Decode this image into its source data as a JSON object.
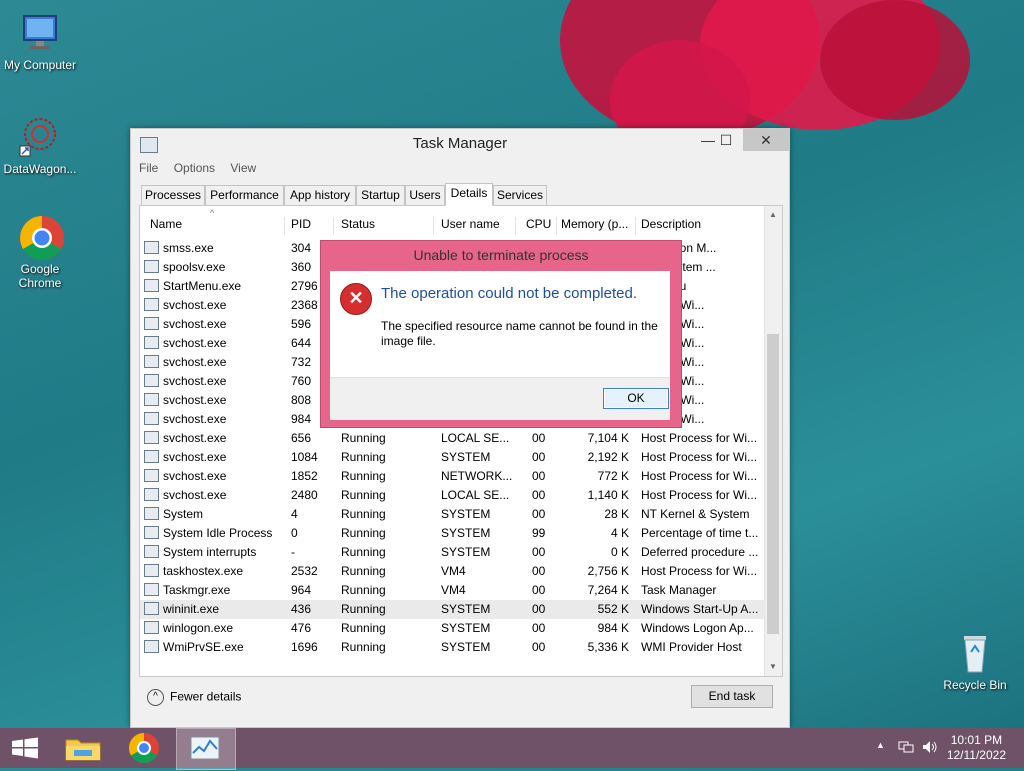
{
  "desktop": {
    "icons": [
      {
        "label": "My Computer",
        "icon": "computer-icon"
      },
      {
        "label": "DataWagon...",
        "icon": "datawagon-icon"
      },
      {
        "label": "Google Chrome",
        "icon": "chrome-icon"
      },
      {
        "label": "Recycle Bin",
        "icon": "recycle-bin-icon"
      }
    ]
  },
  "window": {
    "title": "Task Manager",
    "controls": {
      "minimize": "—",
      "maximize": "☐",
      "close": "✕"
    },
    "menu": [
      "File",
      "Options",
      "View"
    ],
    "tabs": [
      "Processes",
      "Performance",
      "App history",
      "Startup",
      "Users",
      "Details",
      "Services"
    ],
    "active_tab": "Details",
    "columns": [
      "Name",
      "PID",
      "Status",
      "User name",
      "CPU",
      "Memory (p...",
      "Description"
    ],
    "rows": [
      {
        "name": "smss.exe",
        "pid": "304",
        "status": "",
        "user": "",
        "cpu": "",
        "mem": "",
        "desc": "s Session M..."
      },
      {
        "name": "spoolsv.exe",
        "pid": "360",
        "status": "",
        "user": "",
        "cpu": "",
        "mem": "",
        "desc": "SubSystem ..."
      },
      {
        "name": "StartMenu.exe",
        "pid": "2796",
        "status": "",
        "user": "",
        "cpu": "",
        "mem": "",
        "desc": "ell Menu"
      },
      {
        "name": "svchost.exe",
        "pid": "2368",
        "status": "",
        "user": "",
        "cpu": "",
        "mem": "",
        "desc": "ess for Wi..."
      },
      {
        "name": "svchost.exe",
        "pid": "596",
        "status": "",
        "user": "",
        "cpu": "",
        "mem": "",
        "desc": "ess for Wi..."
      },
      {
        "name": "svchost.exe",
        "pid": "644",
        "status": "",
        "user": "",
        "cpu": "",
        "mem": "",
        "desc": "ess for Wi..."
      },
      {
        "name": "svchost.exe",
        "pid": "732",
        "status": "",
        "user": "",
        "cpu": "",
        "mem": "",
        "desc": "ess for Wi..."
      },
      {
        "name": "svchost.exe",
        "pid": "760",
        "status": "",
        "user": "",
        "cpu": "",
        "mem": "",
        "desc": "ess for Wi..."
      },
      {
        "name": "svchost.exe",
        "pid": "808",
        "status": "",
        "user": "",
        "cpu": "",
        "mem": "",
        "desc": "ess for Wi..."
      },
      {
        "name": "svchost.exe",
        "pid": "984",
        "status": "",
        "user": "",
        "cpu": "",
        "mem": "",
        "desc": "ess for Wi..."
      },
      {
        "name": "svchost.exe",
        "pid": "656",
        "status": "Running",
        "user": "LOCAL SE...",
        "cpu": "00",
        "mem": "7,104 K",
        "desc": "Host Process for Wi..."
      },
      {
        "name": "svchost.exe",
        "pid": "1084",
        "status": "Running",
        "user": "SYSTEM",
        "cpu": "00",
        "mem": "2,192 K",
        "desc": "Host Process for Wi..."
      },
      {
        "name": "svchost.exe",
        "pid": "1852",
        "status": "Running",
        "user": "NETWORK...",
        "cpu": "00",
        "mem": "772 K",
        "desc": "Host Process for Wi..."
      },
      {
        "name": "svchost.exe",
        "pid": "2480",
        "status": "Running",
        "user": "LOCAL SE...",
        "cpu": "00",
        "mem": "1,140 K",
        "desc": "Host Process for Wi..."
      },
      {
        "name": "System",
        "pid": "4",
        "status": "Running",
        "user": "SYSTEM",
        "cpu": "00",
        "mem": "28 K",
        "desc": "NT Kernel & System"
      },
      {
        "name": "System Idle Process",
        "pid": "0",
        "status": "Running",
        "user": "SYSTEM",
        "cpu": "99",
        "mem": "4 K",
        "desc": "Percentage of time t..."
      },
      {
        "name": "System interrupts",
        "pid": "-",
        "status": "Running",
        "user": "SYSTEM",
        "cpu": "00",
        "mem": "0 K",
        "desc": "Deferred procedure ..."
      },
      {
        "name": "taskhostex.exe",
        "pid": "2532",
        "status": "Running",
        "user": "VM4",
        "cpu": "00",
        "mem": "2,756 K",
        "desc": "Host Process for Wi..."
      },
      {
        "name": "Taskmgr.exe",
        "pid": "964",
        "status": "Running",
        "user": "VM4",
        "cpu": "00",
        "mem": "7,264 K",
        "desc": "Task Manager"
      },
      {
        "name": "wininit.exe",
        "pid": "436",
        "status": "Running",
        "user": "SYSTEM",
        "cpu": "00",
        "mem": "552 K",
        "desc": "Windows Start-Up A..."
      },
      {
        "name": "winlogon.exe",
        "pid": "476",
        "status": "Running",
        "user": "SYSTEM",
        "cpu": "00",
        "mem": "984 K",
        "desc": "Windows Logon Ap..."
      },
      {
        "name": "WmiPrvSE.exe",
        "pid": "1696",
        "status": "Running",
        "user": "SYSTEM",
        "cpu": "00",
        "mem": "5,336 K",
        "desc": "WMI Provider Host"
      }
    ],
    "selected_row": "wininit.exe",
    "fewer_details": "Fewer details",
    "end_task": "End task"
  },
  "dialog": {
    "title": "Unable to terminate process",
    "main": "The operation could not be completed.",
    "detail": "The specified resource name cannot be found in the image file.",
    "ok": "OK"
  },
  "taskbar": {
    "time": "10:01 PM",
    "date": "12/11/2022"
  },
  "colors": {
    "dialog_frame": "#e7658a",
    "dialog_heading": "#1f4fa0",
    "taskbar": "#6f5268"
  }
}
